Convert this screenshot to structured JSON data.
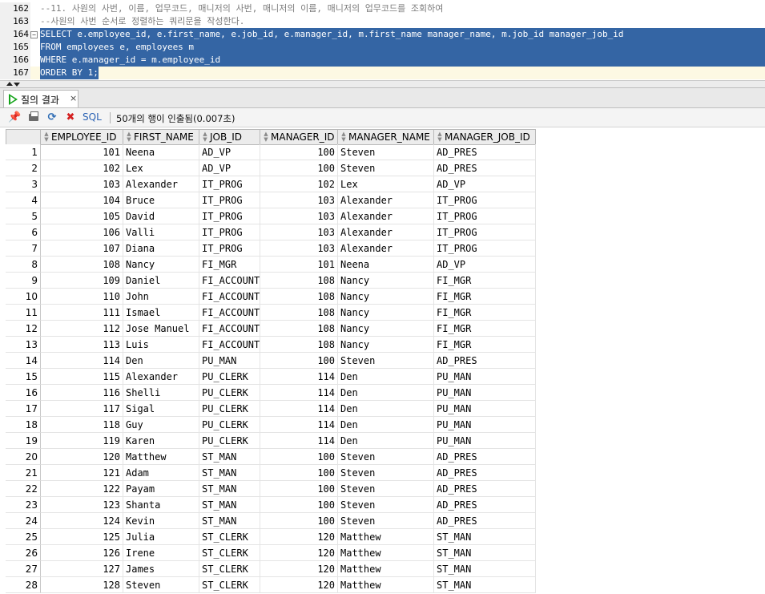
{
  "editor": {
    "lines": [
      {
        "num": "162",
        "text": "--11. 사원의 사번, 이름, 업무코드, 매니저의 사번, 매니저의 이름, 매니저의 업무코드를 조회하여",
        "selected": false,
        "comment": true
      },
      {
        "num": "163",
        "text": "--사원의 사번 순서로 정렬하는 쿼리문을 작성한다.",
        "selected": false,
        "comment": true
      },
      {
        "num": "164",
        "text": "SELECT e.employee_id, e.first_name, e.job_id, e.manager_id, m.first_name manager_name, m.job_id manager_job_id",
        "selected": true,
        "fold": "⊟"
      },
      {
        "num": "165",
        "text": "FROM employees e, employees m",
        "selected": true
      },
      {
        "num": "166",
        "text": "WHERE e.manager_id = m.employee_id",
        "selected": true
      },
      {
        "num": "167",
        "text": "ORDER BY 1;",
        "selected": true
      }
    ]
  },
  "results_tab": {
    "label": "질의 결과",
    "close": "×"
  },
  "toolbar": {
    "sql_label": "SQL",
    "status": "50개의 행이 인출됨(0.007초)"
  },
  "grid": {
    "columns": [
      "EMPLOYEE_ID",
      "FIRST_NAME",
      "JOB_ID",
      "MANAGER_ID",
      "MANAGER_NAME",
      "MANAGER_JOB_ID"
    ],
    "rows": [
      [
        "1",
        "101",
        "Neena",
        "AD_VP",
        "100",
        "Steven",
        "AD_PRES"
      ],
      [
        "2",
        "102",
        "Lex",
        "AD_VP",
        "100",
        "Steven",
        "AD_PRES"
      ],
      [
        "3",
        "103",
        "Alexander",
        "IT_PROG",
        "102",
        "Lex",
        "AD_VP"
      ],
      [
        "4",
        "104",
        "Bruce",
        "IT_PROG",
        "103",
        "Alexander",
        "IT_PROG"
      ],
      [
        "5",
        "105",
        "David",
        "IT_PROG",
        "103",
        "Alexander",
        "IT_PROG"
      ],
      [
        "6",
        "106",
        "Valli",
        "IT_PROG",
        "103",
        "Alexander",
        "IT_PROG"
      ],
      [
        "7",
        "107",
        "Diana",
        "IT_PROG",
        "103",
        "Alexander",
        "IT_PROG"
      ],
      [
        "8",
        "108",
        "Nancy",
        "FI_MGR",
        "101",
        "Neena",
        "AD_VP"
      ],
      [
        "9",
        "109",
        "Daniel",
        "FI_ACCOUNT",
        "108",
        "Nancy",
        "FI_MGR"
      ],
      [
        "10",
        "110",
        "John",
        "FI_ACCOUNT",
        "108",
        "Nancy",
        "FI_MGR"
      ],
      [
        "11",
        "111",
        "Ismael",
        "FI_ACCOUNT",
        "108",
        "Nancy",
        "FI_MGR"
      ],
      [
        "12",
        "112",
        "Jose Manuel",
        "FI_ACCOUNT",
        "108",
        "Nancy",
        "FI_MGR"
      ],
      [
        "13",
        "113",
        "Luis",
        "FI_ACCOUNT",
        "108",
        "Nancy",
        "FI_MGR"
      ],
      [
        "14",
        "114",
        "Den",
        "PU_MAN",
        "100",
        "Steven",
        "AD_PRES"
      ],
      [
        "15",
        "115",
        "Alexander",
        "PU_CLERK",
        "114",
        "Den",
        "PU_MAN"
      ],
      [
        "16",
        "116",
        "Shelli",
        "PU_CLERK",
        "114",
        "Den",
        "PU_MAN"
      ],
      [
        "17",
        "117",
        "Sigal",
        "PU_CLERK",
        "114",
        "Den",
        "PU_MAN"
      ],
      [
        "18",
        "118",
        "Guy",
        "PU_CLERK",
        "114",
        "Den",
        "PU_MAN"
      ],
      [
        "19",
        "119",
        "Karen",
        "PU_CLERK",
        "114",
        "Den",
        "PU_MAN"
      ],
      [
        "20",
        "120",
        "Matthew",
        "ST_MAN",
        "100",
        "Steven",
        "AD_PRES"
      ],
      [
        "21",
        "121",
        "Adam",
        "ST_MAN",
        "100",
        "Steven",
        "AD_PRES"
      ],
      [
        "22",
        "122",
        "Payam",
        "ST_MAN",
        "100",
        "Steven",
        "AD_PRES"
      ],
      [
        "23",
        "123",
        "Shanta",
        "ST_MAN",
        "100",
        "Steven",
        "AD_PRES"
      ],
      [
        "24",
        "124",
        "Kevin",
        "ST_MAN",
        "100",
        "Steven",
        "AD_PRES"
      ],
      [
        "25",
        "125",
        "Julia",
        "ST_CLERK",
        "120",
        "Matthew",
        "ST_MAN"
      ],
      [
        "26",
        "126",
        "Irene",
        "ST_CLERK",
        "120",
        "Matthew",
        "ST_MAN"
      ],
      [
        "27",
        "127",
        "James",
        "ST_CLERK",
        "120",
        "Matthew",
        "ST_MAN"
      ],
      [
        "28",
        "128",
        "Steven",
        "ST_CLERK",
        "120",
        "Matthew",
        "ST_MAN"
      ]
    ]
  }
}
